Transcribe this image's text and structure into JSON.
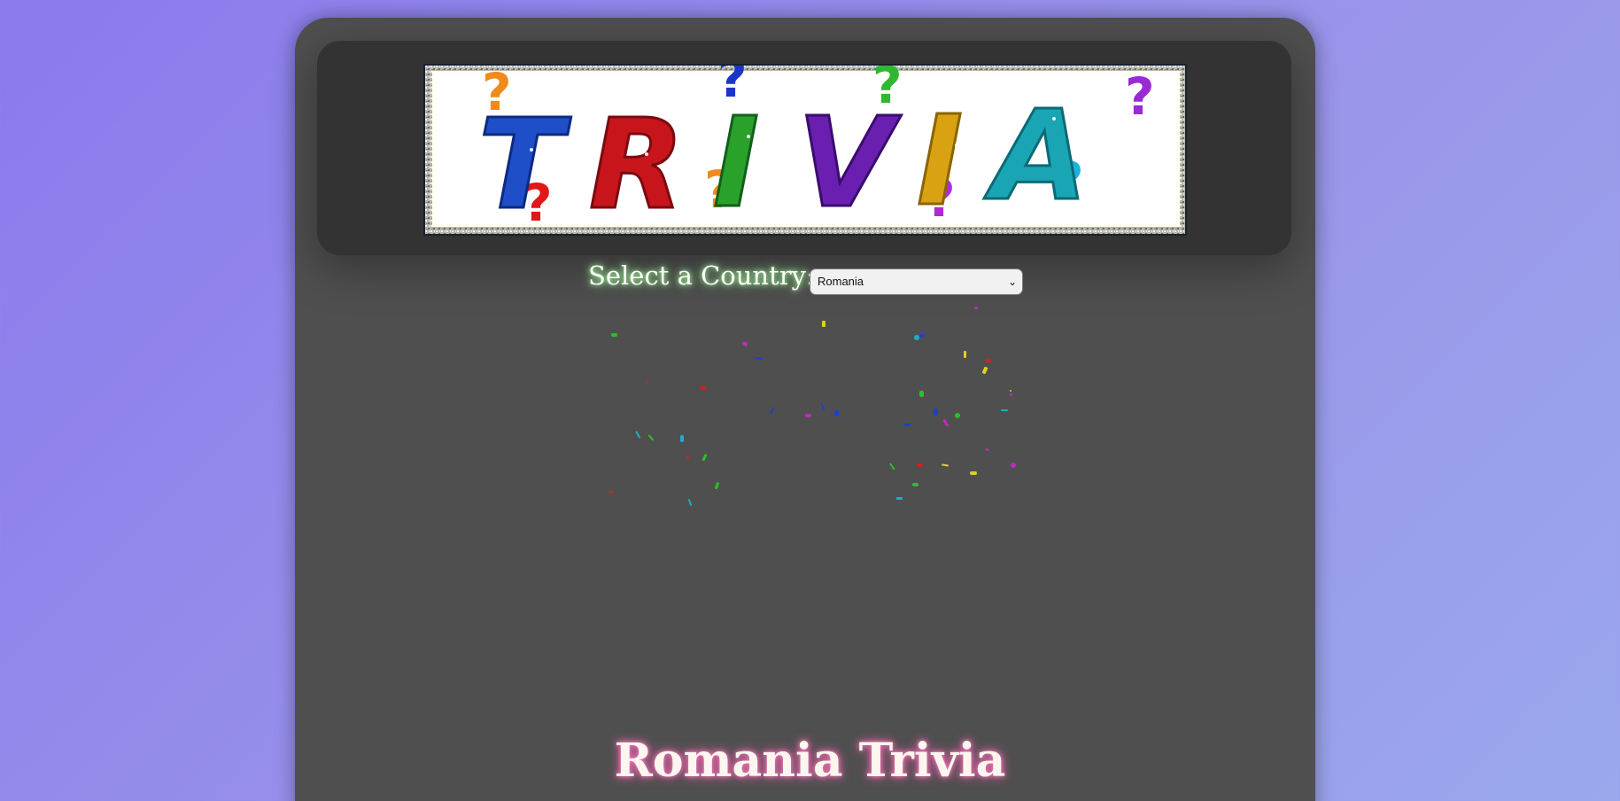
{
  "logo": {
    "name": "trivia-logo",
    "text": "TRIVIA",
    "letter_colors": [
      "#1f4fc8",
      "#c8151c",
      "#2aa12a",
      "#6a1fb0",
      "#d9a212",
      "#1aa5b4"
    ]
  },
  "country_selector": {
    "label": "Select a Country:",
    "selected": "Romania",
    "chevron": "chevron-down-icon"
  },
  "quiz": {
    "title": "Romania Trivia"
  },
  "colors": {
    "page_bg_start": "#8a7aec",
    "page_bg_end": "#9aa8ec",
    "panel_bg": "#4f4f4f",
    "header_bg": "#333333",
    "label_glow": "#8bff88",
    "title_glow": "#ff5fb2"
  }
}
